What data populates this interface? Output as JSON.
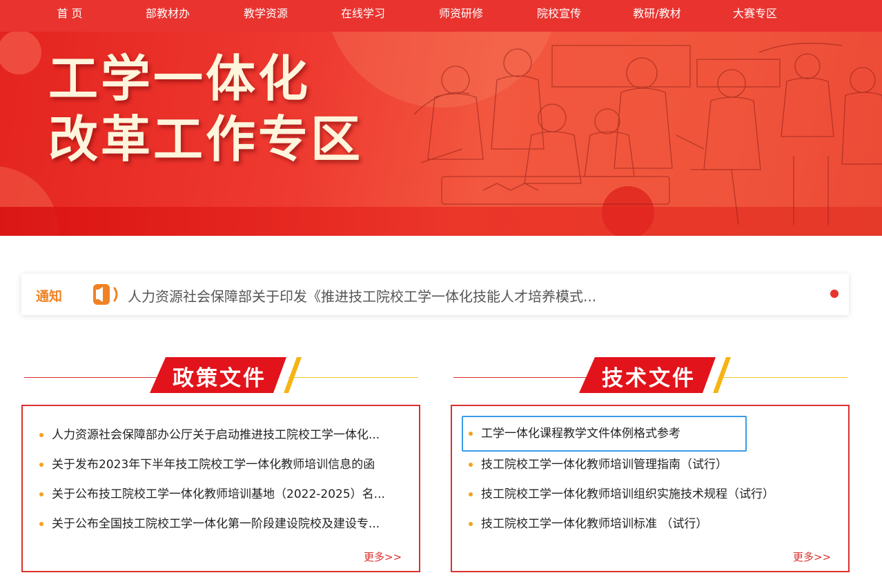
{
  "colors": {
    "brand_red": "#e8332f",
    "accent_orange": "#f08224",
    "bullet_yellow": "#f3a21f",
    "focus_blue": "#3a9ae8"
  },
  "nav": {
    "items": [
      {
        "label": "首 页"
      },
      {
        "label": "部教材办"
      },
      {
        "label": "教学资源"
      },
      {
        "label": "在线学习"
      },
      {
        "label": "师资研修"
      },
      {
        "label": "院校宣传"
      },
      {
        "label": "教研/教材"
      },
      {
        "label": "大赛专区"
      }
    ]
  },
  "banner": {
    "line1": "工学一体化",
    "line2": "改革工作专区"
  },
  "notice": {
    "label": "通知",
    "icon": "speaker-icon",
    "text": "人力资源社会保障部关于印发《推进技工院校工学一体化技能人才培养模式..."
  },
  "policy": {
    "title": "政策文件",
    "items": [
      "人力资源社会保障部办公厅关于启动推进技工院校工学一体化...",
      "关于发布2023年下半年技工院校工学一体化教师培训信息的函",
      "关于公布技工院校工学一体化教师培训基地（2022-2025）名...",
      "关于公布全国技工院校工学一体化第一阶段建设院校及建设专..."
    ],
    "more": "更多>>"
  },
  "tech": {
    "title": "技术文件",
    "items": [
      "工学一体化课程教学文件体例格式参考",
      "技工院校工学一体化教师培训管理指南（试行）",
      "技工院校工学一体化教师培训组织实施技术规程（试行）",
      "技工院校工学一体化教师培训标准 （试行）"
    ],
    "more": "更多>>"
  }
}
